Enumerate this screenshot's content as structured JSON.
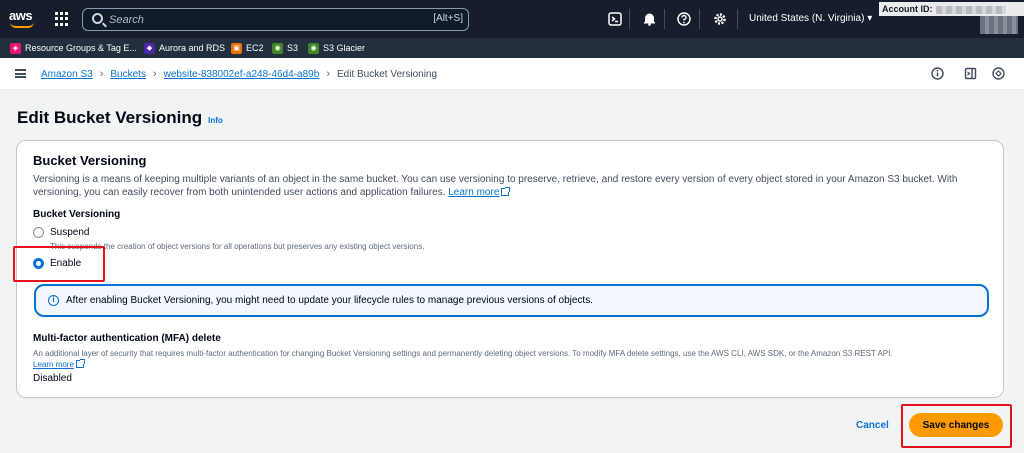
{
  "topnav": {
    "logo_text": "aws",
    "search_placeholder": "Search",
    "search_shortcut": "[Alt+S]",
    "region": "United States (N. Virginia)",
    "account_label": "Account ID:"
  },
  "favorites": [
    {
      "label": "Resource Groups & Tag E...",
      "color": "#e7157b",
      "icon": "resource-groups-icon"
    },
    {
      "label": "Aurora and RDS",
      "color": "#4d27aa",
      "icon": "rds-icon"
    },
    {
      "label": "EC2",
      "color": "#ed7100",
      "icon": "ec2-icon"
    },
    {
      "label": "S3",
      "color": "#3f8624",
      "icon": "s3-icon"
    },
    {
      "label": "S3 Glacier",
      "color": "#3f8624",
      "icon": "s3-glacier-icon"
    }
  ],
  "breadcrumb": {
    "items": [
      "Amazon S3",
      "Buckets",
      "website-838002ef-a248-46d4-a89b"
    ],
    "current": "Edit Bucket Versioning"
  },
  "page": {
    "title": "Edit Bucket Versioning",
    "info_link": "Info"
  },
  "card": {
    "title": "Bucket Versioning",
    "description": "Versioning is a means of keeping multiple variants of an object in the same bucket. You can use versioning to preserve, retrieve, and restore every version of every object stored in your Amazon S3 bucket. With versioning, you can easily recover from both unintended user actions and application failures.",
    "learn_more": "Learn more",
    "field_label": "Bucket Versioning",
    "options": [
      {
        "label": "Suspend",
        "selected": false,
        "description": "This suspends the creation of object versions for all operations but preserves any existing object versions."
      },
      {
        "label": "Enable",
        "selected": true
      }
    ],
    "alert_text": "After enabling Bucket Versioning, you might need to update your lifecycle rules to manage previous versions of objects.",
    "mfa_title": "Multi-factor authentication (MFA) delete",
    "mfa_description": "An additional layer of security that requires multi-factor authentication for changing Bucket Versioning settings and permanently deleting object versions. To modify MFA delete settings, use the AWS CLI, AWS SDK, or the Amazon S3 REST API.",
    "mfa_learn_more": "Learn more",
    "mfa_value": "Disabled"
  },
  "actions": {
    "cancel": "Cancel",
    "save": "Save changes"
  },
  "colors": {
    "accent": "#0972d3",
    "primary_button": "#ff9900",
    "highlight": "#e3121b"
  }
}
